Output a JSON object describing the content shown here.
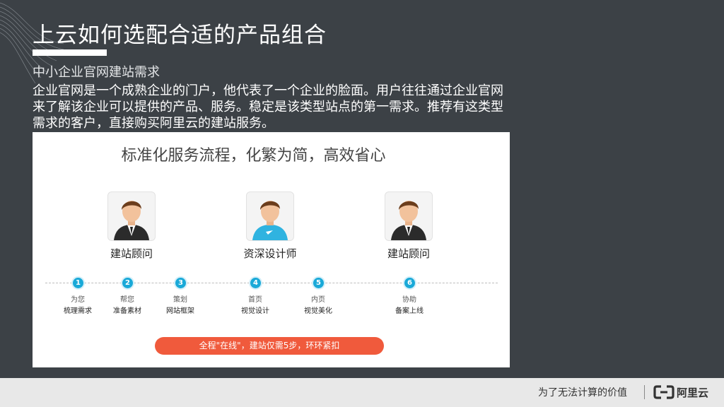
{
  "slide": {
    "title": "上云如何选配合适的产品组合",
    "subtitle": "中小企业官网建站需求",
    "body": "企业官网是一个成熟企业的门户，他代表了一个企业的脸面。用户往往通过企业官网来了解该企业可以提供的产品、服务。稳定是该类型站点的第一需求。推荐有这类型需求的客户，直接购买阿里云的建站服务。"
  },
  "panel": {
    "title": "标准化服务流程，化繁为简，高效省心",
    "roles": [
      {
        "label": "建站顾问",
        "icon": "consultant-avatar-icon"
      },
      {
        "label": "资深设计师",
        "icon": "designer-avatar-icon"
      },
      {
        "label": "建站顾问",
        "icon": "consultant-avatar-icon"
      }
    ],
    "steps": [
      {
        "num": "1",
        "line1": "为您",
        "line2": "梳理需求"
      },
      {
        "num": "2",
        "line1": "帮您",
        "line2": "准备素材"
      },
      {
        "num": "3",
        "line1": "策划",
        "line2": "网站框架"
      },
      {
        "num": "4",
        "line1": "首页",
        "line2": "视觉设计"
      },
      {
        "num": "5",
        "line1": "内页",
        "line2": "视觉美化"
      },
      {
        "num": "6",
        "line1": "协助",
        "line2": "备案上线"
      }
    ],
    "cta": "全程\"在线\"，建站仅需5步，环环紧扣"
  },
  "footer": {
    "slogan": "为了无法计算的价值",
    "logo_text": "阿里云"
  },
  "colors": {
    "background": "#3c4146",
    "accent_blue": "#19a9d8",
    "cta_red": "#f05a3c"
  }
}
